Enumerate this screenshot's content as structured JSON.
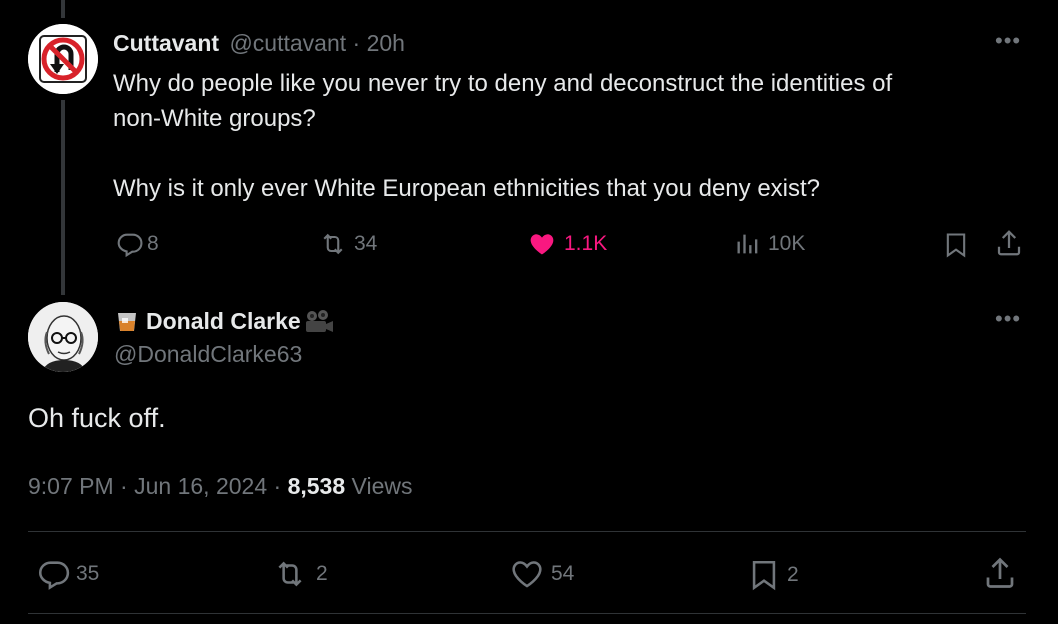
{
  "reply_to": {
    "display_name": "Cuttavant",
    "handle": "@cuttavant",
    "time_sep": "·",
    "time": "20h",
    "text_line1": "Why do people like you never try to deny and deconstruct the identities of",
    "text_line2": "non-White groups?",
    "text_line3": "Why is it only ever White European ethnicities that you deny exist?",
    "replies": "8",
    "reposts": "34",
    "likes": "1.1K",
    "views": "10K",
    "like_color": "#f91880"
  },
  "main_tweet": {
    "display_name": "Donald Clarke",
    "handle": "@DonaldClarke63",
    "text": "Oh fuck off.",
    "time": "9:07 PM",
    "sep1": "·",
    "date": "Jun 16, 2024",
    "sep2": "·",
    "views_count": "8,538",
    "views_label": "Views",
    "replies": "35",
    "reposts": "2",
    "likes": "54",
    "bookmarks": "2"
  },
  "icons": {
    "more": "more-horizontal-icon",
    "reply": "reply-bubble-icon",
    "repost": "repost-icon",
    "like": "heart-icon",
    "views": "views-bar-icon",
    "bookmark": "bookmark-icon",
    "share": "share-icon"
  }
}
